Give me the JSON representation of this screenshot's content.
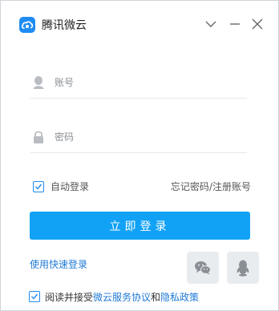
{
  "app": {
    "title": "腾讯微云"
  },
  "login": {
    "account_placeholder": "账号",
    "password_placeholder": "密码",
    "auto_login_label": "自动登录",
    "auto_login_checked": true,
    "forgot_password": "忘记密码",
    "separator": "/",
    "register": "注册账号",
    "login_button": "立即登录",
    "quick_login": "使用快速登录"
  },
  "agreement": {
    "checked": true,
    "prefix": "阅读并接受",
    "service_link": "微云服务协议",
    "conjunction": "和",
    "privacy_link": "隐私政策"
  },
  "icons": {
    "logo": "weiyun-cloud-icon",
    "minimize": "minimize-icon",
    "collapse": "chevron-down-icon",
    "close": "close-icon",
    "account": "user-icon",
    "password": "lock-icon",
    "wechat": "wechat-icon",
    "qq": "qq-icon"
  },
  "colors": {
    "accent": "#12a2f5",
    "link": "#1f7ad6"
  }
}
